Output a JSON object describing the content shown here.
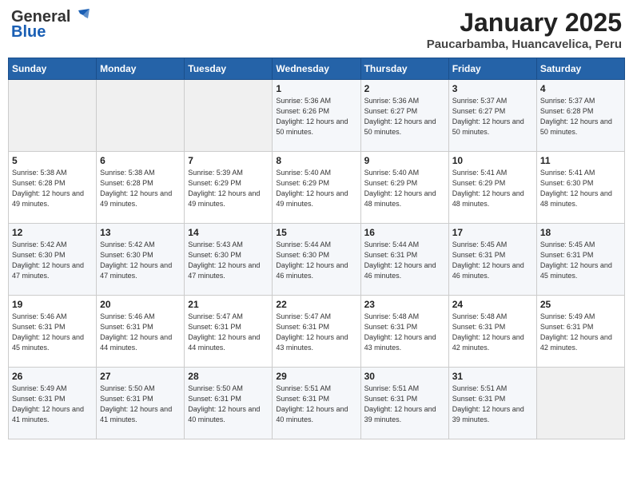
{
  "logo": {
    "general": "General",
    "blue": "Blue"
  },
  "title": "January 2025",
  "subtitle": "Paucarbamba, Huancavelica, Peru",
  "days_of_week": [
    "Sunday",
    "Monday",
    "Tuesday",
    "Wednesday",
    "Thursday",
    "Friday",
    "Saturday"
  ],
  "weeks": [
    [
      {
        "day": "",
        "sunrise": "",
        "sunset": "",
        "daylight": ""
      },
      {
        "day": "",
        "sunrise": "",
        "sunset": "",
        "daylight": ""
      },
      {
        "day": "",
        "sunrise": "",
        "sunset": "",
        "daylight": ""
      },
      {
        "day": "1",
        "sunrise": "Sunrise: 5:36 AM",
        "sunset": "Sunset: 6:26 PM",
        "daylight": "Daylight: 12 hours and 50 minutes."
      },
      {
        "day": "2",
        "sunrise": "Sunrise: 5:36 AM",
        "sunset": "Sunset: 6:27 PM",
        "daylight": "Daylight: 12 hours and 50 minutes."
      },
      {
        "day": "3",
        "sunrise": "Sunrise: 5:37 AM",
        "sunset": "Sunset: 6:27 PM",
        "daylight": "Daylight: 12 hours and 50 minutes."
      },
      {
        "day": "4",
        "sunrise": "Sunrise: 5:37 AM",
        "sunset": "Sunset: 6:28 PM",
        "daylight": "Daylight: 12 hours and 50 minutes."
      }
    ],
    [
      {
        "day": "5",
        "sunrise": "Sunrise: 5:38 AM",
        "sunset": "Sunset: 6:28 PM",
        "daylight": "Daylight: 12 hours and 49 minutes."
      },
      {
        "day": "6",
        "sunrise": "Sunrise: 5:38 AM",
        "sunset": "Sunset: 6:28 PM",
        "daylight": "Daylight: 12 hours and 49 minutes."
      },
      {
        "day": "7",
        "sunrise": "Sunrise: 5:39 AM",
        "sunset": "Sunset: 6:29 PM",
        "daylight": "Daylight: 12 hours and 49 minutes."
      },
      {
        "day": "8",
        "sunrise": "Sunrise: 5:40 AM",
        "sunset": "Sunset: 6:29 PM",
        "daylight": "Daylight: 12 hours and 49 minutes."
      },
      {
        "day": "9",
        "sunrise": "Sunrise: 5:40 AM",
        "sunset": "Sunset: 6:29 PM",
        "daylight": "Daylight: 12 hours and 48 minutes."
      },
      {
        "day": "10",
        "sunrise": "Sunrise: 5:41 AM",
        "sunset": "Sunset: 6:29 PM",
        "daylight": "Daylight: 12 hours and 48 minutes."
      },
      {
        "day": "11",
        "sunrise": "Sunrise: 5:41 AM",
        "sunset": "Sunset: 6:30 PM",
        "daylight": "Daylight: 12 hours and 48 minutes."
      }
    ],
    [
      {
        "day": "12",
        "sunrise": "Sunrise: 5:42 AM",
        "sunset": "Sunset: 6:30 PM",
        "daylight": "Daylight: 12 hours and 47 minutes."
      },
      {
        "day": "13",
        "sunrise": "Sunrise: 5:42 AM",
        "sunset": "Sunset: 6:30 PM",
        "daylight": "Daylight: 12 hours and 47 minutes."
      },
      {
        "day": "14",
        "sunrise": "Sunrise: 5:43 AM",
        "sunset": "Sunset: 6:30 PM",
        "daylight": "Daylight: 12 hours and 47 minutes."
      },
      {
        "day": "15",
        "sunrise": "Sunrise: 5:44 AM",
        "sunset": "Sunset: 6:30 PM",
        "daylight": "Daylight: 12 hours and 46 minutes."
      },
      {
        "day": "16",
        "sunrise": "Sunrise: 5:44 AM",
        "sunset": "Sunset: 6:31 PM",
        "daylight": "Daylight: 12 hours and 46 minutes."
      },
      {
        "day": "17",
        "sunrise": "Sunrise: 5:45 AM",
        "sunset": "Sunset: 6:31 PM",
        "daylight": "Daylight: 12 hours and 46 minutes."
      },
      {
        "day": "18",
        "sunrise": "Sunrise: 5:45 AM",
        "sunset": "Sunset: 6:31 PM",
        "daylight": "Daylight: 12 hours and 45 minutes."
      }
    ],
    [
      {
        "day": "19",
        "sunrise": "Sunrise: 5:46 AM",
        "sunset": "Sunset: 6:31 PM",
        "daylight": "Daylight: 12 hours and 45 minutes."
      },
      {
        "day": "20",
        "sunrise": "Sunrise: 5:46 AM",
        "sunset": "Sunset: 6:31 PM",
        "daylight": "Daylight: 12 hours and 44 minutes."
      },
      {
        "day": "21",
        "sunrise": "Sunrise: 5:47 AM",
        "sunset": "Sunset: 6:31 PM",
        "daylight": "Daylight: 12 hours and 44 minutes."
      },
      {
        "day": "22",
        "sunrise": "Sunrise: 5:47 AM",
        "sunset": "Sunset: 6:31 PM",
        "daylight": "Daylight: 12 hours and 43 minutes."
      },
      {
        "day": "23",
        "sunrise": "Sunrise: 5:48 AM",
        "sunset": "Sunset: 6:31 PM",
        "daylight": "Daylight: 12 hours and 43 minutes."
      },
      {
        "day": "24",
        "sunrise": "Sunrise: 5:48 AM",
        "sunset": "Sunset: 6:31 PM",
        "daylight": "Daylight: 12 hours and 42 minutes."
      },
      {
        "day": "25",
        "sunrise": "Sunrise: 5:49 AM",
        "sunset": "Sunset: 6:31 PM",
        "daylight": "Daylight: 12 hours and 42 minutes."
      }
    ],
    [
      {
        "day": "26",
        "sunrise": "Sunrise: 5:49 AM",
        "sunset": "Sunset: 6:31 PM",
        "daylight": "Daylight: 12 hours and 41 minutes."
      },
      {
        "day": "27",
        "sunrise": "Sunrise: 5:50 AM",
        "sunset": "Sunset: 6:31 PM",
        "daylight": "Daylight: 12 hours and 41 minutes."
      },
      {
        "day": "28",
        "sunrise": "Sunrise: 5:50 AM",
        "sunset": "Sunset: 6:31 PM",
        "daylight": "Daylight: 12 hours and 40 minutes."
      },
      {
        "day": "29",
        "sunrise": "Sunrise: 5:51 AM",
        "sunset": "Sunset: 6:31 PM",
        "daylight": "Daylight: 12 hours and 40 minutes."
      },
      {
        "day": "30",
        "sunrise": "Sunrise: 5:51 AM",
        "sunset": "Sunset: 6:31 PM",
        "daylight": "Daylight: 12 hours and 39 minutes."
      },
      {
        "day": "31",
        "sunrise": "Sunrise: 5:51 AM",
        "sunset": "Sunset: 6:31 PM",
        "daylight": "Daylight: 12 hours and 39 minutes."
      },
      {
        "day": "",
        "sunrise": "",
        "sunset": "",
        "daylight": ""
      }
    ]
  ]
}
